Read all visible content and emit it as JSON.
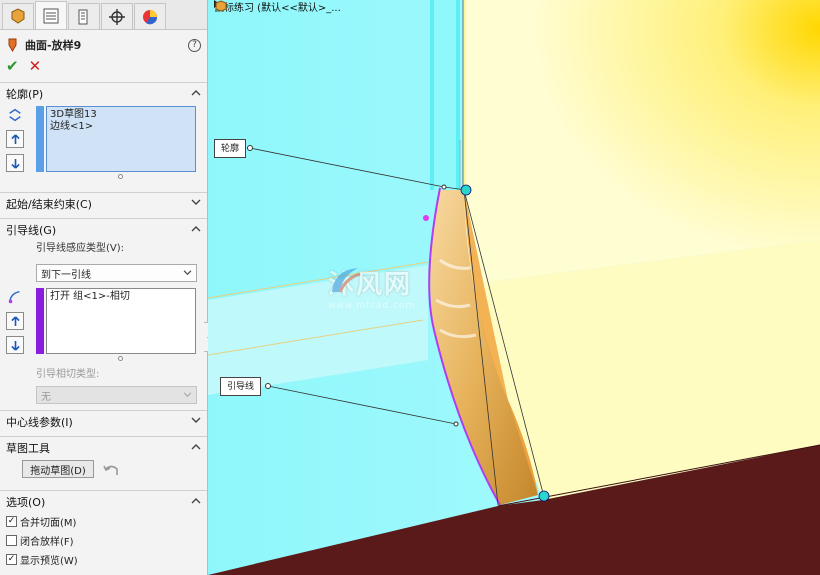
{
  "panel": {
    "feature_title": "曲面-放样9",
    "help_symbol": "?",
    "ok_symbol": "✔",
    "cancel_symbol": "✕",
    "sections": {
      "profile": {
        "label": "轮廓(P)",
        "items": [
          "3D草图13",
          "边线<1>"
        ]
      },
      "start_end": {
        "label": "起始/结束约束(C)"
      },
      "guides": {
        "label": "引导线(G)",
        "influence_label": "引导线感应类型(V):",
        "influence_value": "到下一引线",
        "items": [
          "打开 组<1>-相切"
        ],
        "tangency_label": "引导相切类型:",
        "tangency_value": "无"
      },
      "centerline": {
        "label": "中心线参数(I)"
      },
      "sketch_tools": {
        "label": "草图工具",
        "drag_button": "拖动草图(D)"
      },
      "options": {
        "label": "选项(O)",
        "checks": [
          {
            "label": "合并切面(M)",
            "checked": true
          },
          {
            "label": "闭合放样(F)",
            "checked": false
          },
          {
            "label": "显示预览(W)",
            "checked": true
          }
        ]
      }
    }
  },
  "viewport": {
    "tree_text": "鼠标练习  (默认<<默认>_...",
    "callout_profile": "轮廓",
    "callout_guide": "引导线",
    "watermark": "沐风网",
    "watermark_url": "www.mfcad.com"
  },
  "colors": {
    "accent_blue": "#5b9fe6",
    "guide_purple": "#8a1ce0",
    "floor": "#5a1a1a",
    "cyan": "#7ff5f9",
    "yellow": "#fffcb0"
  }
}
